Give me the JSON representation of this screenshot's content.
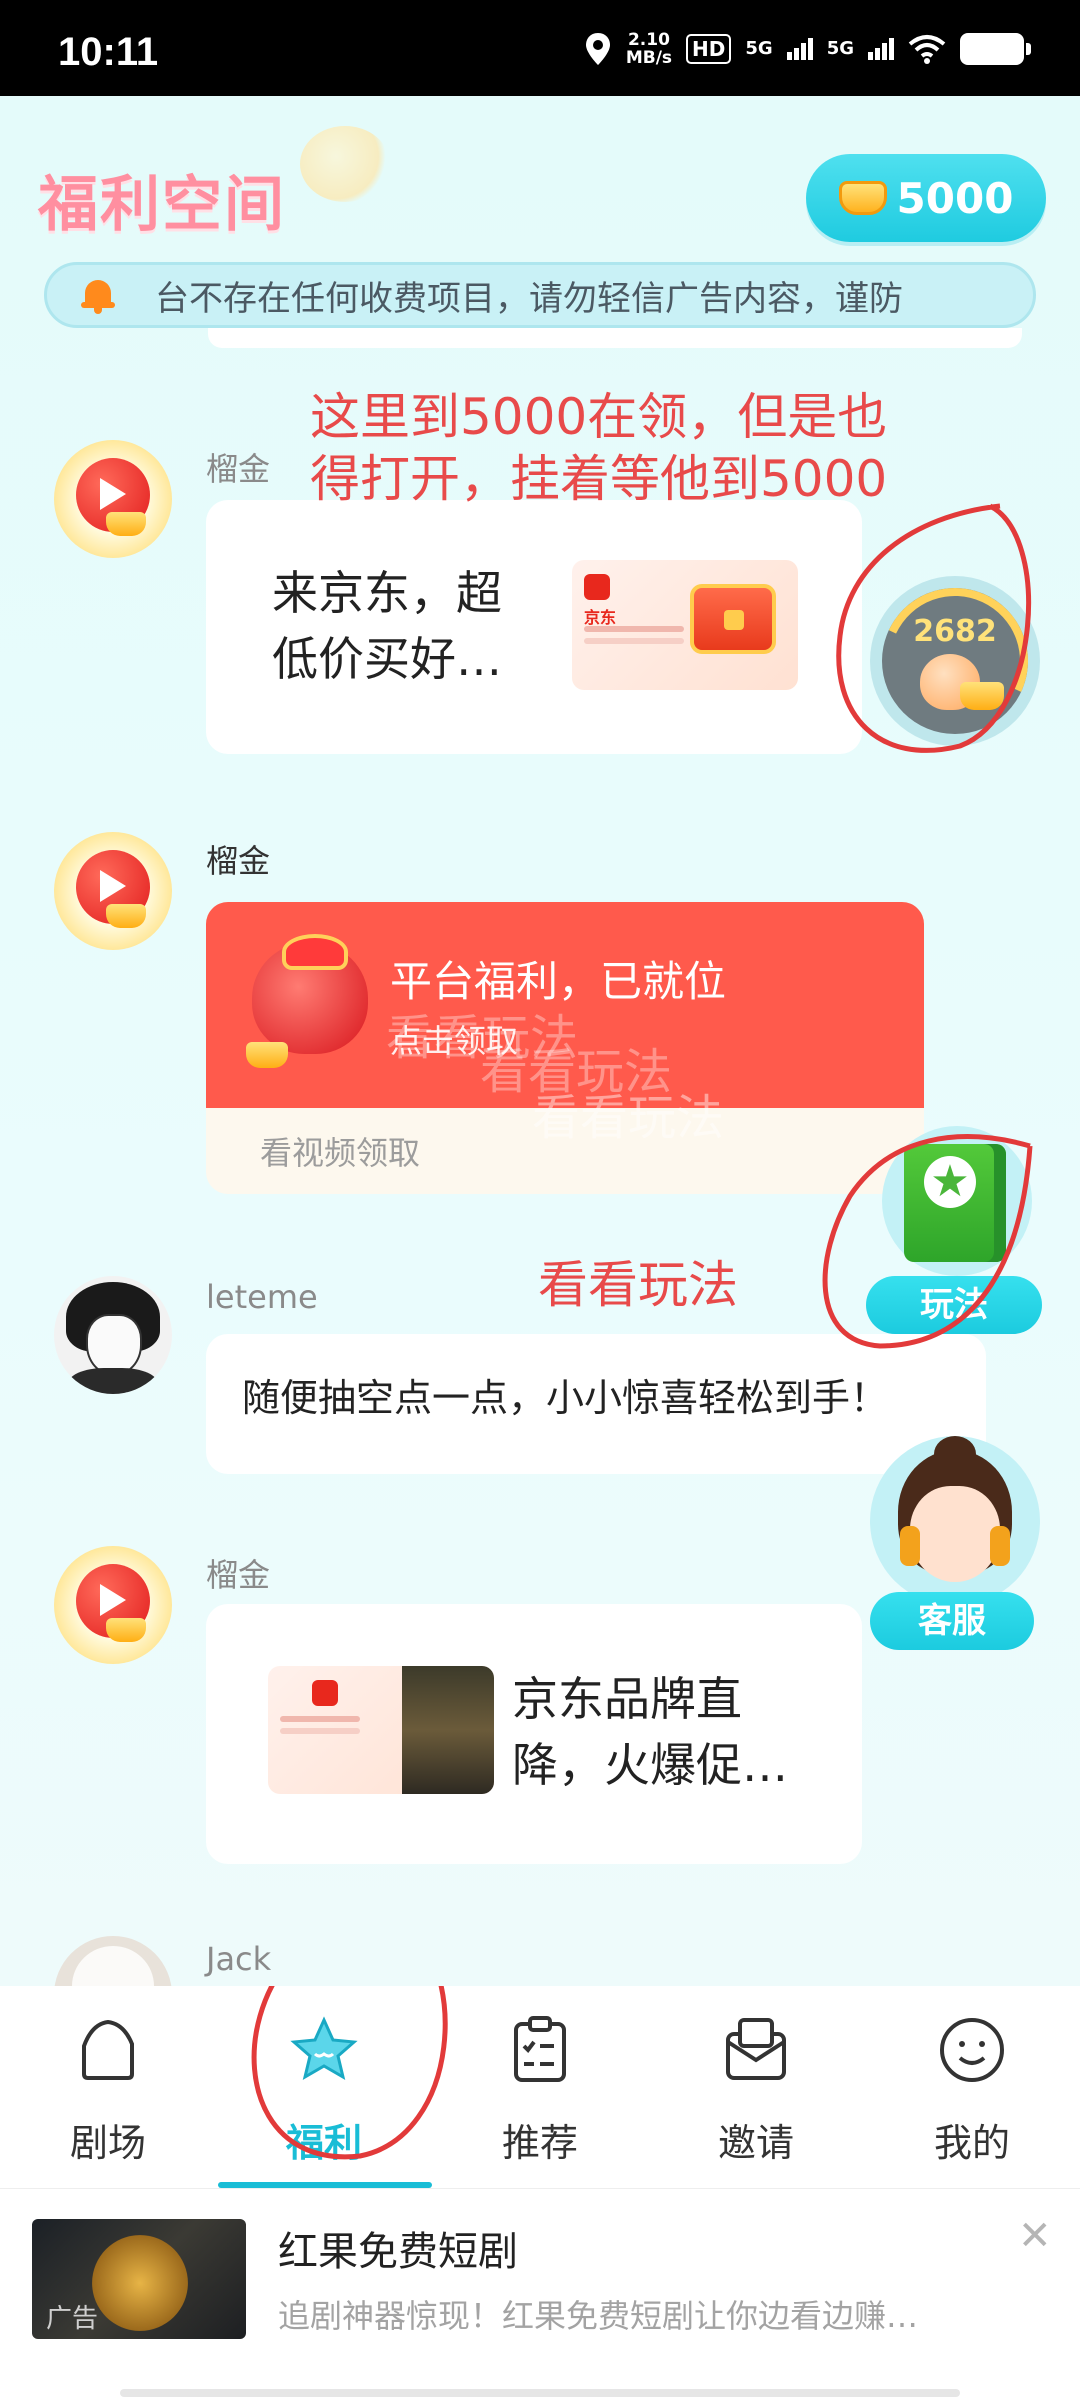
{
  "status_bar": {
    "time": "10:11",
    "net_speed_value": "2.10",
    "net_speed_unit": "MB/s",
    "hd_label": "HD",
    "sim1": "5G",
    "sim2": "5G"
  },
  "header": {
    "title": "福利空间",
    "coin_balance": "5000",
    "notice_text": "台不存在任何收费项目，请勿轻信广告内容，谨防"
  },
  "messages": [
    {
      "sender": "榴金",
      "text": "来京东，超\n低价买好…",
      "thumb_brand": "京东"
    },
    {
      "sender": "榴金",
      "welfare_title": "平台福利，已就位",
      "welfare_sub": "点击领取",
      "welfare_action": "看视频领取"
    },
    {
      "sender": "leteme",
      "text": "随便抽空点一点，小小惊喜轻松到手！"
    },
    {
      "sender": "榴金",
      "text": "京东品牌直\n降，火爆促…"
    },
    {
      "sender": "Jack"
    }
  ],
  "watermark": [
    "看看玩法",
    "看看玩法",
    "看看玩法"
  ],
  "floating": {
    "peach_count": "2682",
    "rules_label": "玩法",
    "service_label": "客服"
  },
  "annotations": {
    "top_note": "这里到5000在领，但是也\n得打开，挂着等他到5000",
    "rules_note": "看看玩法"
  },
  "tabs": [
    {
      "label": "剧场",
      "icon": "theater-icon"
    },
    {
      "label": "福利",
      "icon": "welfare-star-icon",
      "active": true
    },
    {
      "label": "推荐",
      "icon": "recommend-clipboard-icon"
    },
    {
      "label": "邀请",
      "icon": "invite-envelope-icon"
    },
    {
      "label": "我的",
      "icon": "profile-smile-icon"
    }
  ],
  "ad": {
    "title": "红果免费短剧",
    "description": "追剧神器惊现！红果免费短剧让你边看边赚…",
    "tag": "广告"
  },
  "colors": {
    "accent": "#19bdd6",
    "welfare_red": "#ff5a4c",
    "annotation_red": "#e84a4a",
    "coin_pill": "#1fcbe0"
  }
}
